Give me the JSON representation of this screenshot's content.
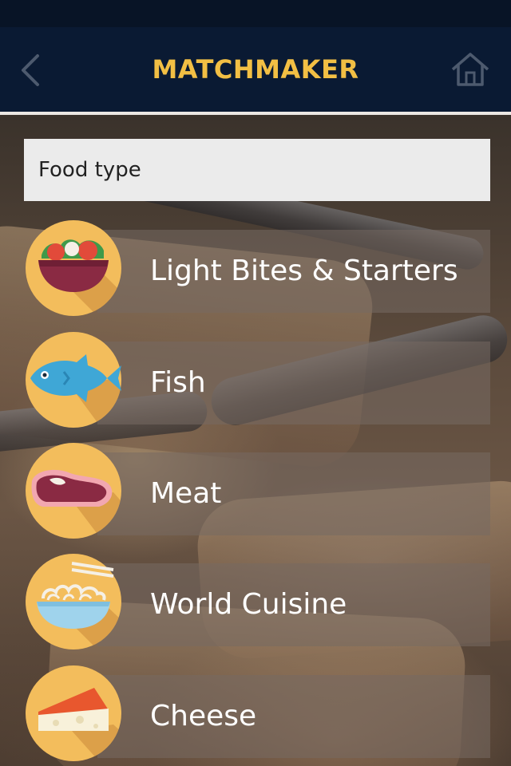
{
  "header": {
    "title": "MATCHMAKER",
    "back_icon": "chevron-left-icon",
    "home_icon": "home-icon",
    "background": "#0a1a33",
    "accent": "#f2bf44"
  },
  "search": {
    "placeholder": "Food type",
    "value": ""
  },
  "food_types": [
    {
      "label": "Light Bites & Starters",
      "icon": "salad-bowl-icon"
    },
    {
      "label": "Fish",
      "icon": "fish-icon"
    },
    {
      "label": "Meat",
      "icon": "steak-icon"
    },
    {
      "label": "World Cuisine",
      "icon": "noodle-bowl-icon"
    },
    {
      "label": "Cheese",
      "icon": "cheese-icon"
    }
  ]
}
